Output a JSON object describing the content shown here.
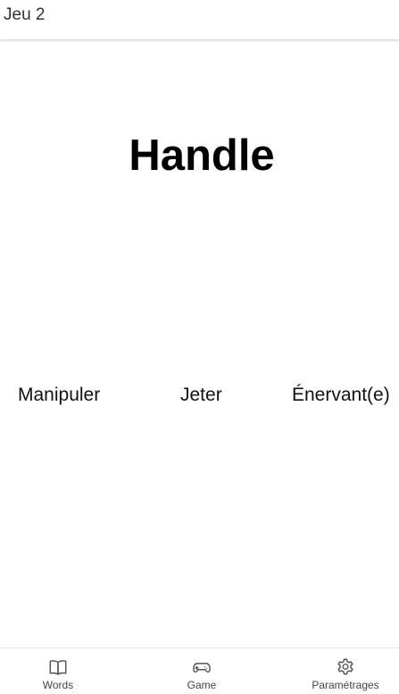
{
  "header": {
    "title": "Jeu 2"
  },
  "main": {
    "word": "Handle",
    "options": [
      {
        "label": "Manipuler"
      },
      {
        "label": "Jeter"
      },
      {
        "label": "Énervant(e)"
      }
    ]
  },
  "bottom_nav": {
    "items": [
      {
        "label": "Words",
        "icon": "book-icon"
      },
      {
        "label": "Game",
        "icon": "gamepad-icon"
      },
      {
        "label": "Paramétrages",
        "icon": "gear-icon"
      }
    ]
  },
  "colors": {
    "text": "#000000",
    "nav_icon": "#555555",
    "nav_label": "#444444",
    "divider": "#e6e6e6"
  }
}
